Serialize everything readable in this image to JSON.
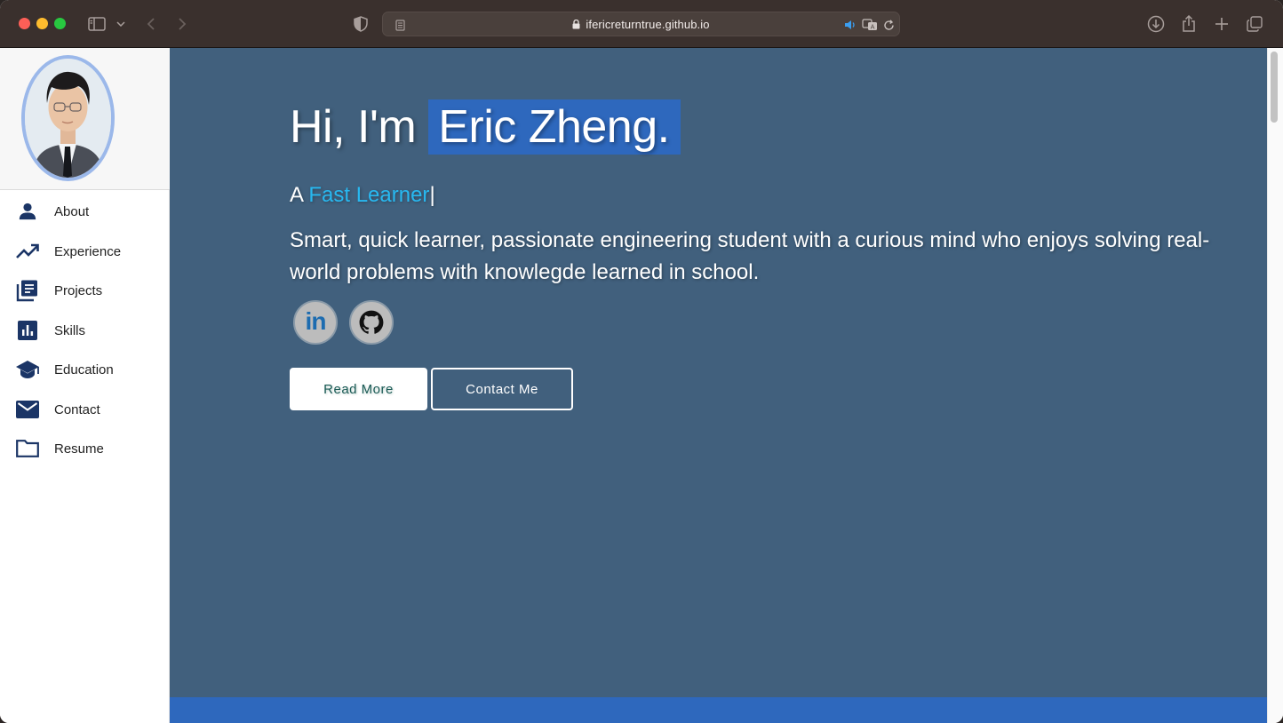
{
  "browser": {
    "url": "ifericreturntrue.github.io"
  },
  "sidebar": {
    "items": [
      {
        "label": "About",
        "icon": "person-icon"
      },
      {
        "label": "Experience",
        "icon": "trending-up-icon"
      },
      {
        "label": "Projects",
        "icon": "library-books-icon"
      },
      {
        "label": "Skills",
        "icon": "bar-chart-icon"
      },
      {
        "label": "Education",
        "icon": "graduation-cap-icon"
      },
      {
        "label": "Contact",
        "icon": "mail-icon"
      },
      {
        "label": "Resume",
        "icon": "folder-icon"
      }
    ]
  },
  "hero": {
    "greeting_prefix": "Hi, I'm",
    "name": "Eric Zheng.",
    "role_prefix": "A",
    "role": "Fast Learner",
    "cursor": "|",
    "tagline": "Smart, quick learner, passionate engineering student with a curious mind who enjoys solving real-world problems with knowlegde learned in school.",
    "linkedin_label": "in",
    "read_more_label": "Read More",
    "contact_label": "Contact Me"
  },
  "colors": {
    "hero_bg": "#41607d",
    "accent": "#2e68bd",
    "role_text": "#28b8f0",
    "nav_icon": "#1b3566"
  }
}
